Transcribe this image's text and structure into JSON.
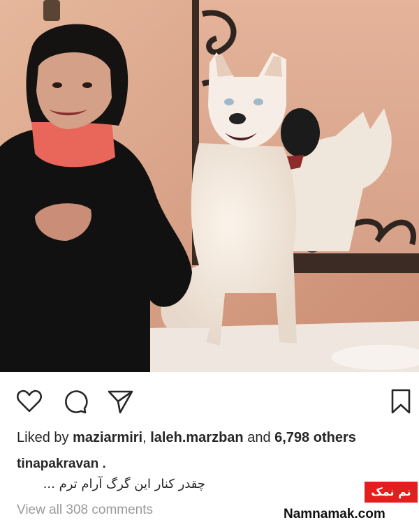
{
  "post": {
    "likes_prefix": "Liked by ",
    "liker1": "maziarmiri",
    "sep": ", ",
    "liker2": "laleh.marzban",
    "likes_mid": " and ",
    "others_count": "6,798",
    "likes_suffix": " others",
    "username": "tinapakravan .",
    "caption": "چقدر کنار این گرگ آرام ترم ...",
    "view_comments": "View all 308 comments"
  },
  "watermark": {
    "logo_text": "نم نمک",
    "site": "Namnamak.com"
  },
  "icons": {
    "like": "heart-icon",
    "comment": "comment-icon",
    "share": "share-icon",
    "save": "bookmark-icon"
  },
  "colors": {
    "text": "#262626",
    "muted": "#999999",
    "brand_red": "#e21e1e"
  }
}
